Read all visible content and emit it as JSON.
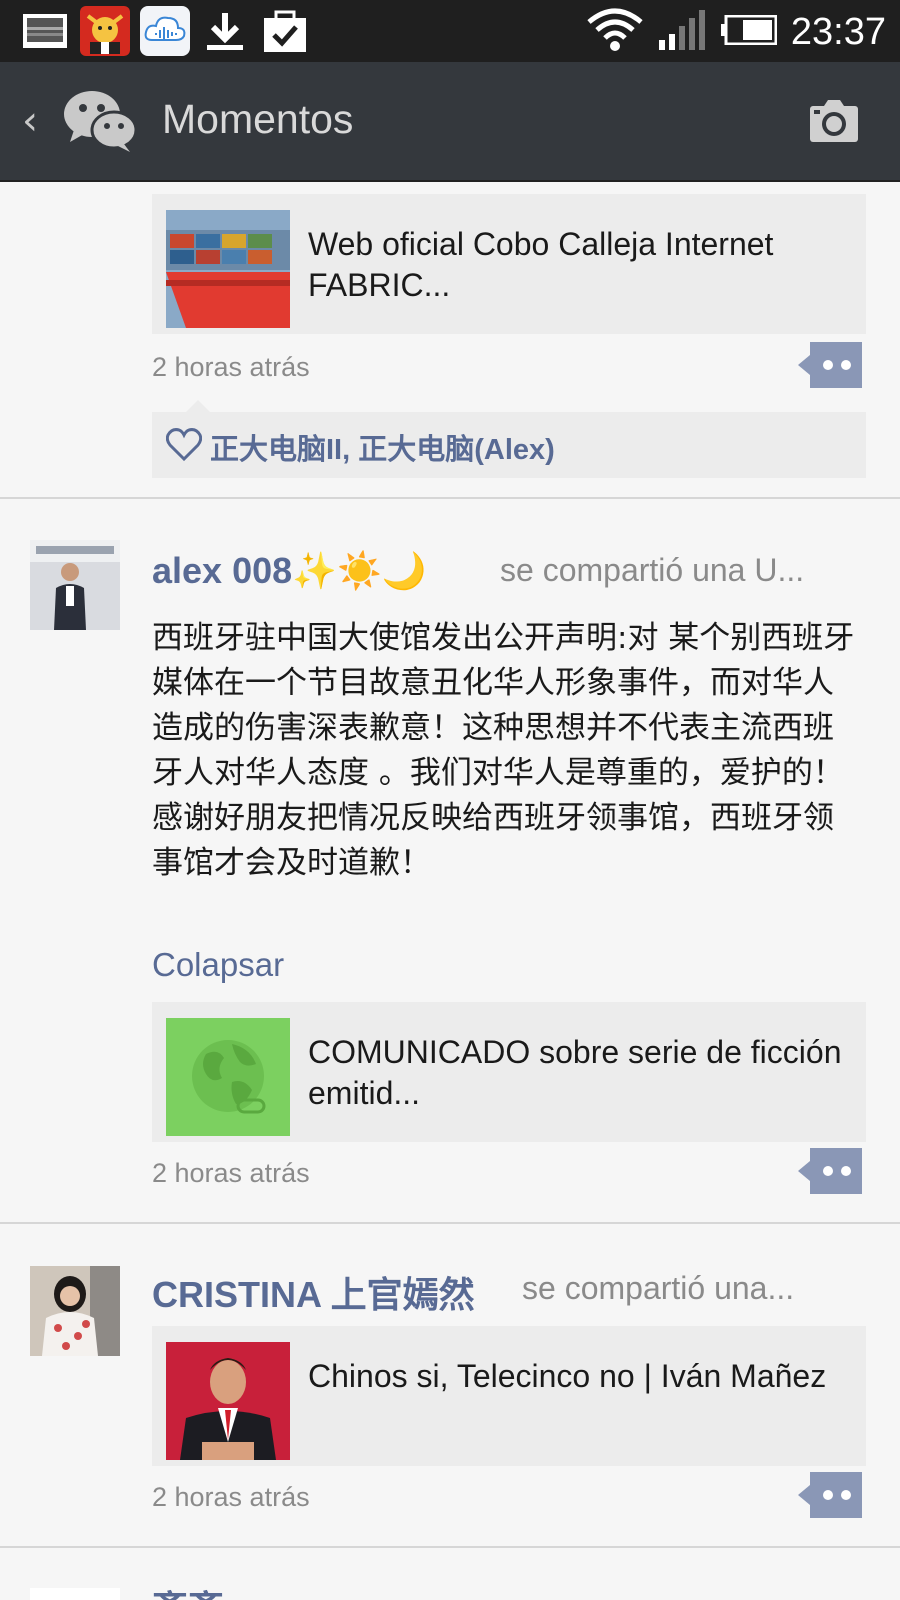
{
  "status_bar": {
    "time": "23:37",
    "icons": [
      "screenshot-icon",
      "app-cow-icon",
      "cloud-voice-icon",
      "download-icon",
      "task-check-icon",
      "wifi-icon",
      "signal-icon",
      "battery-icon"
    ]
  },
  "header": {
    "title": "Momentos",
    "back_icon": "chevron-left-icon",
    "logo_icon": "wechat-logo-icon",
    "camera_icon": "camera-icon"
  },
  "feed": {
    "posts": [
      {
        "link_title": "Web oficial Cobo Calleja Internet FABRIC...",
        "time": "2 horas atrás",
        "likes": "正大电脑II, 正大电脑(Alex)"
      },
      {
        "author": "alex 008✨☀️🌙",
        "action": "se compartió una U...",
        "text": "西班牙驻中国大使馆发出公开声明:对 某个别西班牙媒体在一个节目故意丑化华人形象事件，而对华人造成的伤害深表歉意！这种思想并不代表主流西班牙人对华人态度 。我们对华人是尊重的，爱护的！感谢好朋友把情况反映给西班牙领事馆，西班牙领事馆才会及时道歉！",
        "collapse_label": "Colapsar",
        "link_title": "COMUNICADO sobre serie de ficción emitid...",
        "time": "2 horas atrás"
      },
      {
        "author": "CRISTINA 上官嫣然",
        "action": "se compartió una...",
        "link_title": "Chinos si, Telecinco no | Iván Mañez",
        "time": "2 horas atrás"
      },
      {
        "author": "斎斎"
      }
    ]
  },
  "colors": {
    "name_blue": "#586a94",
    "comment_button": "#8a97b6",
    "action_bar": "#34383d"
  }
}
